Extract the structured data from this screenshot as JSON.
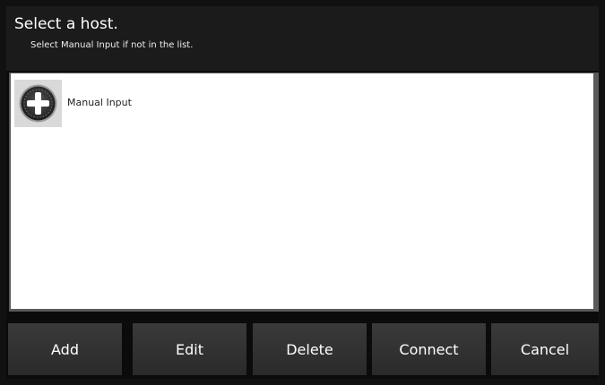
{
  "header": {
    "title": "Select a host.",
    "subtitle": "Select Manual Input if not in the list."
  },
  "host_list": {
    "items": [
      {
        "label": "Manual Input",
        "icon": "plus-circle-icon"
      }
    ]
  },
  "buttons": {
    "add": "Add",
    "edit": "Edit",
    "delete": "Delete",
    "connect": "Connect",
    "cancel": "Cancel"
  },
  "colors": {
    "background": "#111111",
    "header": "#1b1b1b",
    "list_background": "#ffffff",
    "button": "#333333"
  }
}
